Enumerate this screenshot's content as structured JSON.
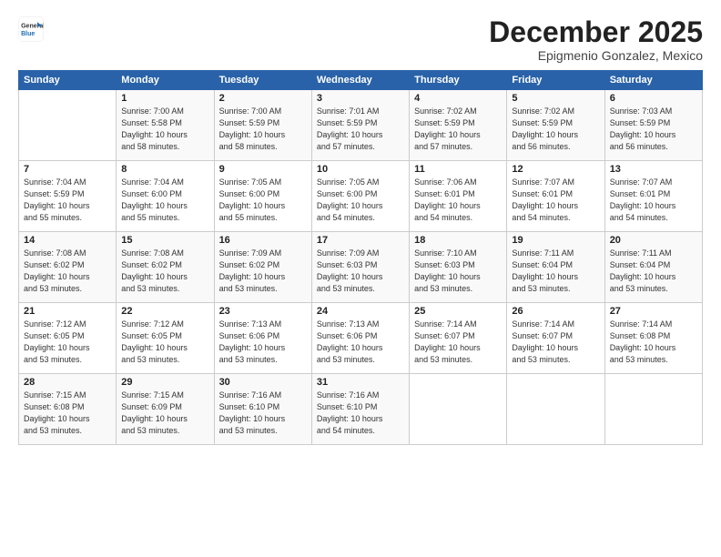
{
  "header": {
    "logo_line1": "General",
    "logo_line2": "Blue",
    "month": "December 2025",
    "location": "Epigmenio Gonzalez, Mexico"
  },
  "weekdays": [
    "Sunday",
    "Monday",
    "Tuesday",
    "Wednesday",
    "Thursday",
    "Friday",
    "Saturday"
  ],
  "weeks": [
    [
      {
        "day": "",
        "detail": ""
      },
      {
        "day": "1",
        "detail": "Sunrise: 7:00 AM\nSunset: 5:58 PM\nDaylight: 10 hours\nand 58 minutes."
      },
      {
        "day": "2",
        "detail": "Sunrise: 7:00 AM\nSunset: 5:59 PM\nDaylight: 10 hours\nand 58 minutes."
      },
      {
        "day": "3",
        "detail": "Sunrise: 7:01 AM\nSunset: 5:59 PM\nDaylight: 10 hours\nand 57 minutes."
      },
      {
        "day": "4",
        "detail": "Sunrise: 7:02 AM\nSunset: 5:59 PM\nDaylight: 10 hours\nand 57 minutes."
      },
      {
        "day": "5",
        "detail": "Sunrise: 7:02 AM\nSunset: 5:59 PM\nDaylight: 10 hours\nand 56 minutes."
      },
      {
        "day": "6",
        "detail": "Sunrise: 7:03 AM\nSunset: 5:59 PM\nDaylight: 10 hours\nand 56 minutes."
      }
    ],
    [
      {
        "day": "7",
        "detail": "Sunrise: 7:04 AM\nSunset: 5:59 PM\nDaylight: 10 hours\nand 55 minutes."
      },
      {
        "day": "8",
        "detail": "Sunrise: 7:04 AM\nSunset: 6:00 PM\nDaylight: 10 hours\nand 55 minutes."
      },
      {
        "day": "9",
        "detail": "Sunrise: 7:05 AM\nSunset: 6:00 PM\nDaylight: 10 hours\nand 55 minutes."
      },
      {
        "day": "10",
        "detail": "Sunrise: 7:05 AM\nSunset: 6:00 PM\nDaylight: 10 hours\nand 54 minutes."
      },
      {
        "day": "11",
        "detail": "Sunrise: 7:06 AM\nSunset: 6:01 PM\nDaylight: 10 hours\nand 54 minutes."
      },
      {
        "day": "12",
        "detail": "Sunrise: 7:07 AM\nSunset: 6:01 PM\nDaylight: 10 hours\nand 54 minutes."
      },
      {
        "day": "13",
        "detail": "Sunrise: 7:07 AM\nSunset: 6:01 PM\nDaylight: 10 hours\nand 54 minutes."
      }
    ],
    [
      {
        "day": "14",
        "detail": "Sunrise: 7:08 AM\nSunset: 6:02 PM\nDaylight: 10 hours\nand 53 minutes."
      },
      {
        "day": "15",
        "detail": "Sunrise: 7:08 AM\nSunset: 6:02 PM\nDaylight: 10 hours\nand 53 minutes."
      },
      {
        "day": "16",
        "detail": "Sunrise: 7:09 AM\nSunset: 6:02 PM\nDaylight: 10 hours\nand 53 minutes."
      },
      {
        "day": "17",
        "detail": "Sunrise: 7:09 AM\nSunset: 6:03 PM\nDaylight: 10 hours\nand 53 minutes."
      },
      {
        "day": "18",
        "detail": "Sunrise: 7:10 AM\nSunset: 6:03 PM\nDaylight: 10 hours\nand 53 minutes."
      },
      {
        "day": "19",
        "detail": "Sunrise: 7:11 AM\nSunset: 6:04 PM\nDaylight: 10 hours\nand 53 minutes."
      },
      {
        "day": "20",
        "detail": "Sunrise: 7:11 AM\nSunset: 6:04 PM\nDaylight: 10 hours\nand 53 minutes."
      }
    ],
    [
      {
        "day": "21",
        "detail": "Sunrise: 7:12 AM\nSunset: 6:05 PM\nDaylight: 10 hours\nand 53 minutes."
      },
      {
        "day": "22",
        "detail": "Sunrise: 7:12 AM\nSunset: 6:05 PM\nDaylight: 10 hours\nand 53 minutes."
      },
      {
        "day": "23",
        "detail": "Sunrise: 7:13 AM\nSunset: 6:06 PM\nDaylight: 10 hours\nand 53 minutes."
      },
      {
        "day": "24",
        "detail": "Sunrise: 7:13 AM\nSunset: 6:06 PM\nDaylight: 10 hours\nand 53 minutes."
      },
      {
        "day": "25",
        "detail": "Sunrise: 7:14 AM\nSunset: 6:07 PM\nDaylight: 10 hours\nand 53 minutes."
      },
      {
        "day": "26",
        "detail": "Sunrise: 7:14 AM\nSunset: 6:07 PM\nDaylight: 10 hours\nand 53 minutes."
      },
      {
        "day": "27",
        "detail": "Sunrise: 7:14 AM\nSunset: 6:08 PM\nDaylight: 10 hours\nand 53 minutes."
      }
    ],
    [
      {
        "day": "28",
        "detail": "Sunrise: 7:15 AM\nSunset: 6:08 PM\nDaylight: 10 hours\nand 53 minutes."
      },
      {
        "day": "29",
        "detail": "Sunrise: 7:15 AM\nSunset: 6:09 PM\nDaylight: 10 hours\nand 53 minutes."
      },
      {
        "day": "30",
        "detail": "Sunrise: 7:16 AM\nSunset: 6:10 PM\nDaylight: 10 hours\nand 53 minutes."
      },
      {
        "day": "31",
        "detail": "Sunrise: 7:16 AM\nSunset: 6:10 PM\nDaylight: 10 hours\nand 54 minutes."
      },
      {
        "day": "",
        "detail": ""
      },
      {
        "day": "",
        "detail": ""
      },
      {
        "day": "",
        "detail": ""
      }
    ]
  ]
}
